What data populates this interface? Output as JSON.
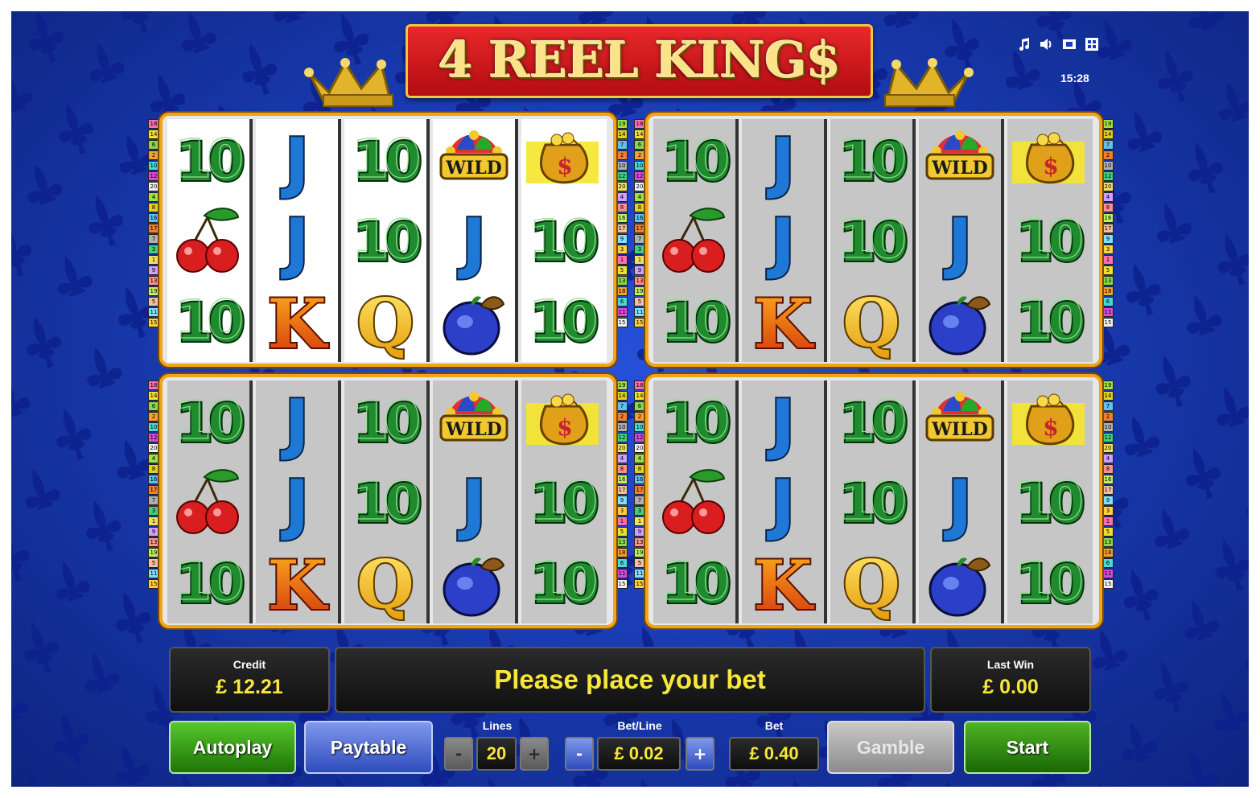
{
  "game": {
    "title": "4 REEL KING$",
    "clock": "15:28"
  },
  "top_icons": [
    "music-icon",
    "sound-icon",
    "fullscreen-icon",
    "settings-icon"
  ],
  "reels": {
    "symbols_by_reel": [
      [
        "10",
        "cherry",
        "10"
      ],
      [
        "J",
        "J",
        "K"
      ],
      [
        "10",
        "10",
        "Q"
      ],
      [
        "wild",
        "J",
        "plum"
      ],
      [
        "moneybag",
        "10",
        "10"
      ]
    ],
    "wild_label": "WILD",
    "active_grid": 0
  },
  "payline_numbers": {
    "left": [
      "18",
      "14",
      "6",
      "2",
      "10",
      "12",
      "20",
      "4",
      "8",
      "16",
      "17",
      "7",
      "3",
      "1",
      "9",
      "13",
      "19",
      "5",
      "11",
      "15"
    ],
    "right": [
      "19",
      "14",
      "7",
      "2",
      "10",
      "12",
      "20",
      "4",
      "8",
      "16",
      "17",
      "9",
      "3",
      "1",
      "5",
      "13",
      "18",
      "6",
      "11",
      "15"
    ]
  },
  "panels": {
    "credit_label": "Credit",
    "credit_value": "£ 12.21",
    "message": "Please place your bet",
    "last_win_label": "Last Win",
    "last_win_value": "£ 0.00"
  },
  "controls": {
    "autoplay": "Autoplay",
    "paytable": "Paytable",
    "lines_label": "Lines",
    "lines_value": "20",
    "betline_label": "Bet/Line",
    "betline_value": "£ 0.02",
    "bet_label": "Bet",
    "bet_value": "£ 0.40",
    "gamble": "Gamble",
    "start": "Start",
    "minus": "-",
    "plus": "+"
  },
  "colors": {
    "background": "#1a3cb4",
    "frame_gold": "#f1a417",
    "value_yellow": "#f7e73a",
    "autoplay_green": "#2f9a12",
    "paytable_blue": "#4f6fd8",
    "start_green": "#2a8a10"
  }
}
